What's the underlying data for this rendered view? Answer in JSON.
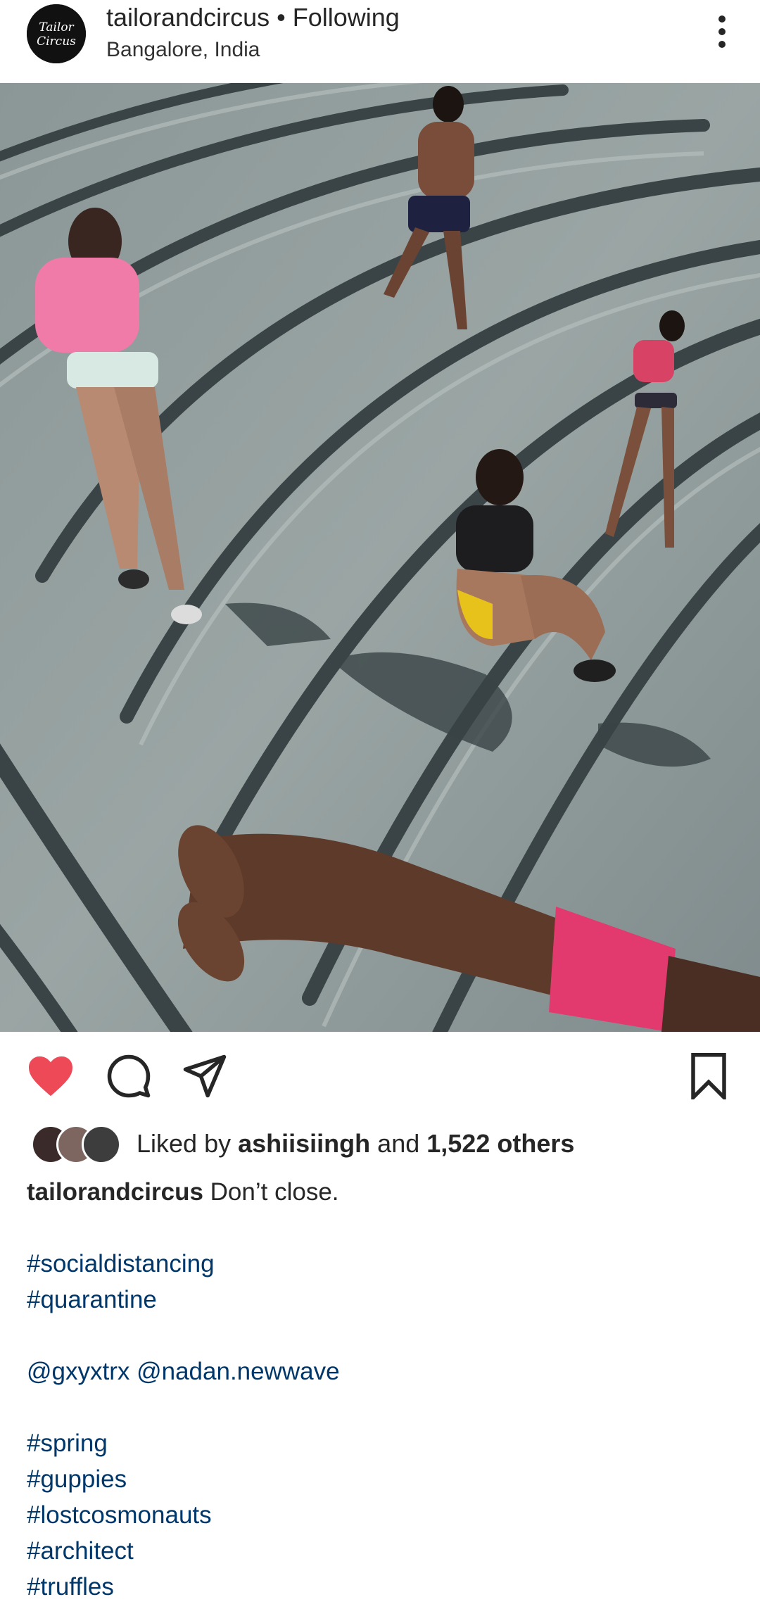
{
  "post": {
    "username": "tailorandcircus",
    "follow_state": "• Following",
    "location": "Bangalore, India",
    "avatar_text_line1": "Tailor",
    "avatar_text_line2": "Circus"
  },
  "icons": {
    "more": "more-vertical-icon",
    "like": "heart-filled-icon",
    "comment": "comment-bubble-icon",
    "share": "paper-plane-icon",
    "save": "bookmark-icon"
  },
  "colors": {
    "like": "#ed4956",
    "hashtag": "#00376b",
    "text": "#262626"
  },
  "likes": {
    "prefix": "Liked by",
    "liker": "ashiisiingh",
    "joiner": "and",
    "others": "1,522 others"
  },
  "caption": {
    "username": "tailorandcircus",
    "text": "Don’t close.",
    "tags_group1": [
      "#socialdistancing",
      "#quarantine"
    ],
    "mentions": "@gxyxtrx @nadan.newwave",
    "tags_group2": [
      "#spring",
      "#guppies",
      "#lostcosmonauts",
      "#architect",
      "#truffles"
    ]
  }
}
